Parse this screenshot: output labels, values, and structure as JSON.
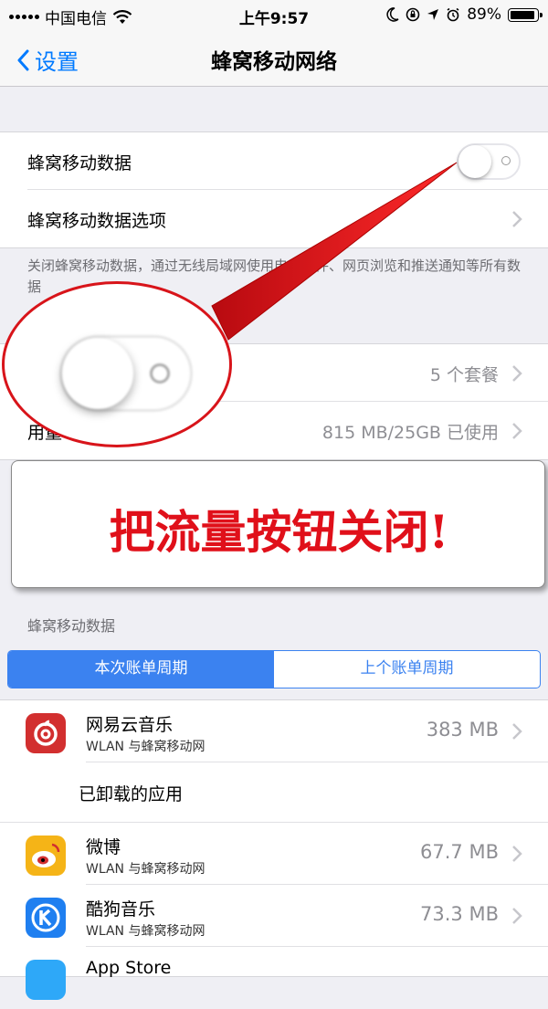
{
  "status_bar": {
    "carrier": "中国电信",
    "time": "上午9:57",
    "battery": "89%"
  },
  "nav": {
    "back_label": "设置",
    "title": "蜂窝移动网络"
  },
  "cellular": {
    "toggle_label": "蜂窝移动数据",
    "toggle_on": false,
    "options_label": "蜂窝移动数据选项",
    "footnote": "关闭蜂窝移动数据，通过无线局域网使用电子邮件、网页浏览和推送通知等所有数据"
  },
  "plans": {
    "plan_detail": "5 个套餐",
    "usage_label": "用量",
    "usage_detail": "815 MB/25GB 已使用"
  },
  "annotation": {
    "text": "把流量按钮关闭!"
  },
  "usage_section": {
    "header": "蜂窝移动数据",
    "segments": [
      "本次账单周期",
      "上个账单周期"
    ],
    "apps": [
      {
        "name": "网易云音乐",
        "sub": "WLAN 与蜂窝移动网",
        "size": "383 MB",
        "icon": "netease-music-icon",
        "color": "#d22f2f"
      }
    ],
    "uninstalled_label": "已卸载的应用",
    "apps2": [
      {
        "name": "微博",
        "sub": "WLAN 与蜂窝移动网",
        "size": "67.7 MB",
        "icon": "weibo-icon",
        "color": "#f5b417"
      },
      {
        "name": "酷狗音乐",
        "sub": "WLAN 与蜂窝移动网",
        "size": "73.3 MB",
        "icon": "kugou-icon",
        "color": "#1f7ff0"
      }
    ],
    "partial_app": {
      "name": "App Store",
      "icon": "app-store-icon",
      "color": "#2ea8f8"
    }
  }
}
